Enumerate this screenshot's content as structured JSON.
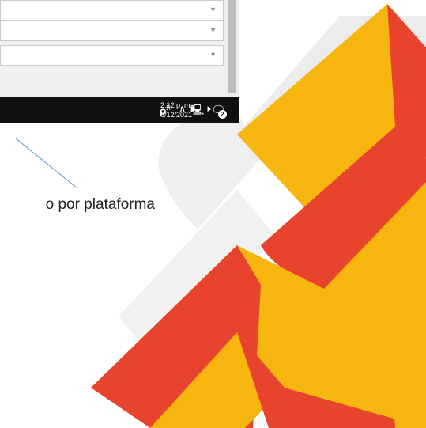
{
  "taskbar": {
    "time": "2:12 p. m.",
    "date": "6/12/2021",
    "notification_count": "2",
    "icons": [
      "people-icon",
      "chevron-up-icon",
      "network-icon",
      "volume-icon",
      "action-center-icon"
    ]
  },
  "dialog": {
    "dropdowns": [
      {
        "value": "",
        "arrow": "▼"
      },
      {
        "value": "",
        "arrow": "▼"
      },
      {
        "value": "",
        "arrow": "▼"
      }
    ]
  },
  "caption": "o por plataforma",
  "colors": {
    "orange": "#f7b50f",
    "red": "#e8432d",
    "gray_shape": "#e9e9e9",
    "taskbar": "#101010"
  }
}
